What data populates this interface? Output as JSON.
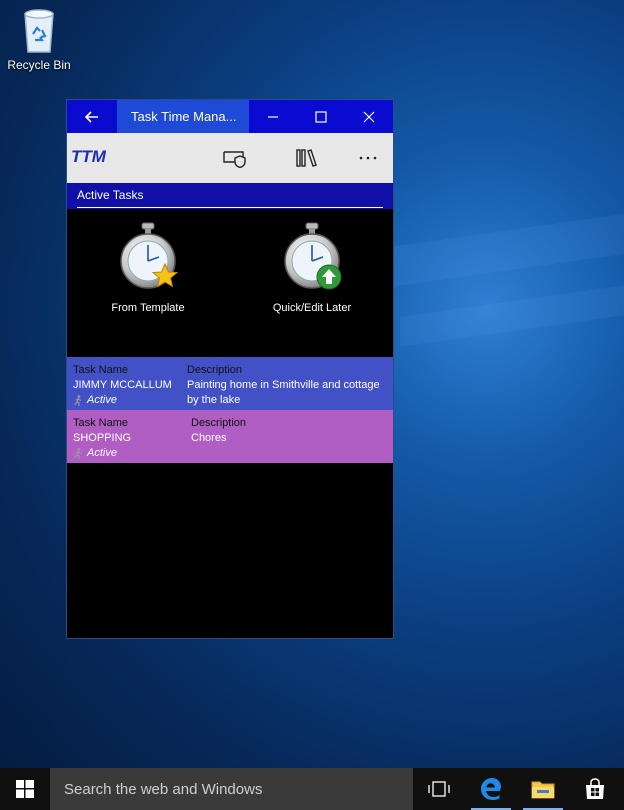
{
  "desktop": {
    "recycle_bin_label": "Recycle Bin"
  },
  "window": {
    "title": "Task Time Mana...",
    "app_logo": "TTM",
    "section_title": "Active Tasks",
    "actions": [
      {
        "label": "From Template",
        "icon": "stopwatch-star-icon"
      },
      {
        "label": "Quick/Edit Later",
        "icon": "stopwatch-arrow-icon"
      }
    ],
    "tasks": [
      {
        "name_header": "Task Name",
        "name": "JIMMY MCCALLUM",
        "status": "Active",
        "desc_header": "Description",
        "description": "Painting home in Smithville and cottage by the lake",
        "color": "#4351c6"
      },
      {
        "name_header": "Task Name",
        "name": "SHOPPING",
        "status": "Active",
        "desc_header": "Description",
        "description": "Chores",
        "color": "#b05ec4"
      }
    ]
  },
  "taskbar": {
    "search_placeholder": "Search the web and Windows"
  },
  "colors": {
    "titlebar": "#0a0ad0",
    "section": "#1010a8"
  }
}
